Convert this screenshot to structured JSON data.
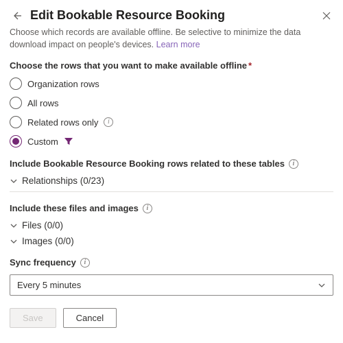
{
  "header": {
    "title": "Edit Bookable Resource Booking",
    "subtitle": "Choose which records are available offline. Be selective to minimize the data download impact on people's devices.",
    "learn_more": "Learn more"
  },
  "rows_group": {
    "label": "Choose the rows that you want to make available offline",
    "options": {
      "org": "Organization rows",
      "all": "All rows",
      "related": "Related rows only",
      "custom": "Custom"
    },
    "selected": "custom"
  },
  "related_tables": {
    "label": "Include Bookable Resource Booking rows related to these tables",
    "expander": "Relationships (0/23)"
  },
  "files_images": {
    "label": "Include these files and images",
    "files": "Files (0/0)",
    "images": "Images (0/0)"
  },
  "sync": {
    "label": "Sync frequency",
    "value": "Every 5 minutes"
  },
  "footer": {
    "save": "Save",
    "cancel": "Cancel"
  }
}
